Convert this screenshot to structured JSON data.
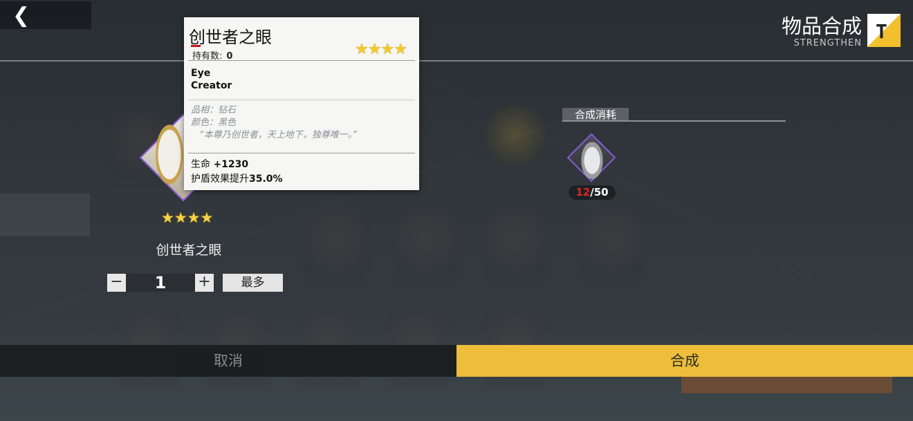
{
  "header": {
    "back_icon": "chevron-left-icon",
    "title": "物品合成",
    "subtitle": "STRENGTHEN",
    "title_icon": "hammer-icon",
    "accent_color": "#eebe3a"
  },
  "item": {
    "name": "创世者之眼",
    "stars": "★★★★",
    "quantity": "1",
    "minus_label": "−",
    "plus_label": "+",
    "max_label": "最多"
  },
  "tooltip": {
    "title": "创世者之眼",
    "count_label": "持有数:",
    "count_value": "0",
    "stars": "★★★★",
    "en_line1": "Eye",
    "en_line2": "Creator",
    "quality": "品相：钻石",
    "color": "颜色：黑色",
    "quote": "“本尊乃创世者，天上地下，独尊唯一。”",
    "stat1_label": "生命 ",
    "stat1_value": "+1230",
    "stat2_label": "护盾效果提升",
    "stat2_value": "35.0%"
  },
  "cost": {
    "label": "合成消耗",
    "have": "12",
    "need": "/50",
    "have_color": "#e0261f"
  },
  "footer": {
    "cancel_label": "取消",
    "confirm_label": "合成"
  }
}
